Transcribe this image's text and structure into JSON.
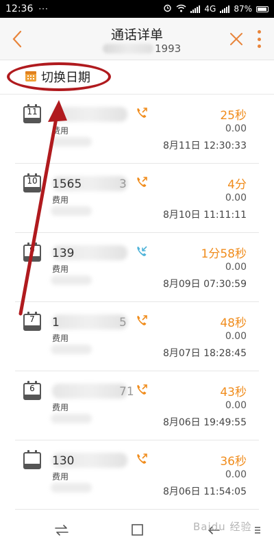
{
  "status_bar": {
    "time": "12:36",
    "dots": "···",
    "network": "4G",
    "battery": "87%"
  },
  "header": {
    "title": "通话详单",
    "subtitle_digits": "1993"
  },
  "date_switch": {
    "label": "切换日期"
  },
  "records": [
    {
      "day": "11",
      "number": "",
      "tail": "",
      "call_type": "outgoing",
      "fee_label": "费用",
      "duration": "25秒",
      "cost": "0.00",
      "datetime": "8月11日  12:30:33"
    },
    {
      "day": "10",
      "number": "1565",
      "tail": "3",
      "call_type": "outgoing",
      "fee_label": "费用",
      "duration": "4分",
      "cost": "0.00",
      "datetime": "8月10日  11:11:11"
    },
    {
      "day": "9",
      "number": "139",
      "tail": "",
      "call_type": "incoming",
      "fee_label": "费用",
      "duration": "1分58秒",
      "cost": "0.00",
      "datetime": "8月09日  07:30:59"
    },
    {
      "day": "7",
      "number": "1",
      "tail": "5",
      "call_type": "outgoing",
      "fee_label": "费用",
      "duration": "48秒",
      "cost": "0.00",
      "datetime": "8月07日  18:28:45"
    },
    {
      "day": "6",
      "number": "",
      "tail": "71",
      "call_type": "outgoing",
      "fee_label": "费用",
      "duration": "43秒",
      "cost": "0.00",
      "datetime": "8月06日  19:49:55"
    },
    {
      "day": "",
      "number": "130",
      "tail": "",
      "call_type": "outgoing",
      "fee_label": "费用",
      "duration": "36秒",
      "cost": "0.00",
      "datetime": "8月06日  11:54:05"
    }
  ],
  "watermark": "Baidu 经验",
  "colors": {
    "accent": "#f08c1c",
    "annotation": "#b01a1e",
    "incoming": "#4fb3d9"
  }
}
